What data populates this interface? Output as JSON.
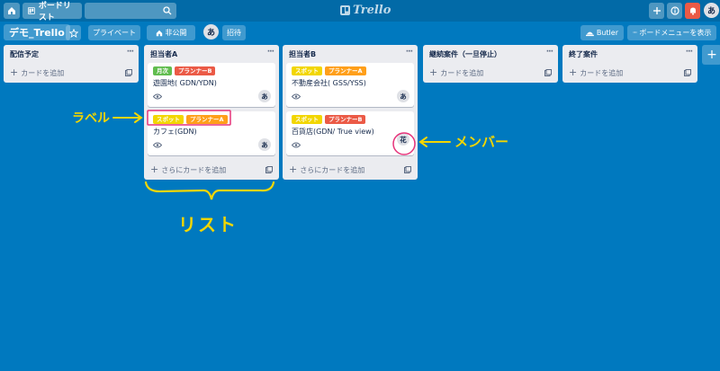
{
  "header": {
    "boards_label": "ボードリスト",
    "logo_text": "Trello",
    "avatar": "あ"
  },
  "board": {
    "title": "デモ_Trello",
    "visibility_label": "プライベート",
    "team_label": "非公開",
    "member_avatar": "あ",
    "invite_label": "招待",
    "butler_label": "Butler",
    "menu_label": "ボードメニューを表示"
  },
  "labels_colors": {
    "green": "#61bd4f",
    "red": "#eb5a46",
    "yellow": "#f2d600",
    "orange": "#ff9f1a"
  },
  "lists": [
    {
      "title": "配信予定",
      "cards": [],
      "add_label": "カードを追加"
    },
    {
      "title": "担当者A",
      "cards": [
        {
          "labels": [
            {
              "text": "月次",
              "color": "#61bd4f"
            },
            {
              "text": "プランナーB",
              "color": "#eb5a46"
            }
          ],
          "title": "遊園地( GDN/YDN)",
          "member": "あ"
        },
        {
          "labels": [
            {
              "text": "スポット",
              "color": "#f2d600"
            },
            {
              "text": "プランナーA",
              "color": "#ff9f1a"
            }
          ],
          "title": "カフェ(GDN)",
          "member": "あ"
        }
      ],
      "add_label": "さらにカードを追加"
    },
    {
      "title": "担当者B",
      "cards": [
        {
          "labels": [
            {
              "text": "スポット",
              "color": "#f2d600"
            },
            {
              "text": "プランナーA",
              "color": "#ff9f1a"
            }
          ],
          "title": "不動産会社( GSS/YSS)",
          "member": "あ"
        },
        {
          "labels": [
            {
              "text": "スポット",
              "color": "#f2d600"
            },
            {
              "text": "プランナーB",
              "color": "#eb5a46"
            }
          ],
          "title": "百貨店(GDN/ True view)",
          "member": "花"
        }
      ],
      "add_label": "さらにカードを追加"
    },
    {
      "title": "継続案件（一旦停止）",
      "cards": [],
      "add_label": "カードを追加"
    },
    {
      "title": "終了案件",
      "cards": [],
      "add_label": "カードを追加"
    }
  ],
  "annotations": {
    "label_note": "ラベル",
    "list_note": "リスト",
    "member_note": "メンバー",
    "arrow_color": "#f2d600",
    "highlight_color": "#e6337a"
  }
}
